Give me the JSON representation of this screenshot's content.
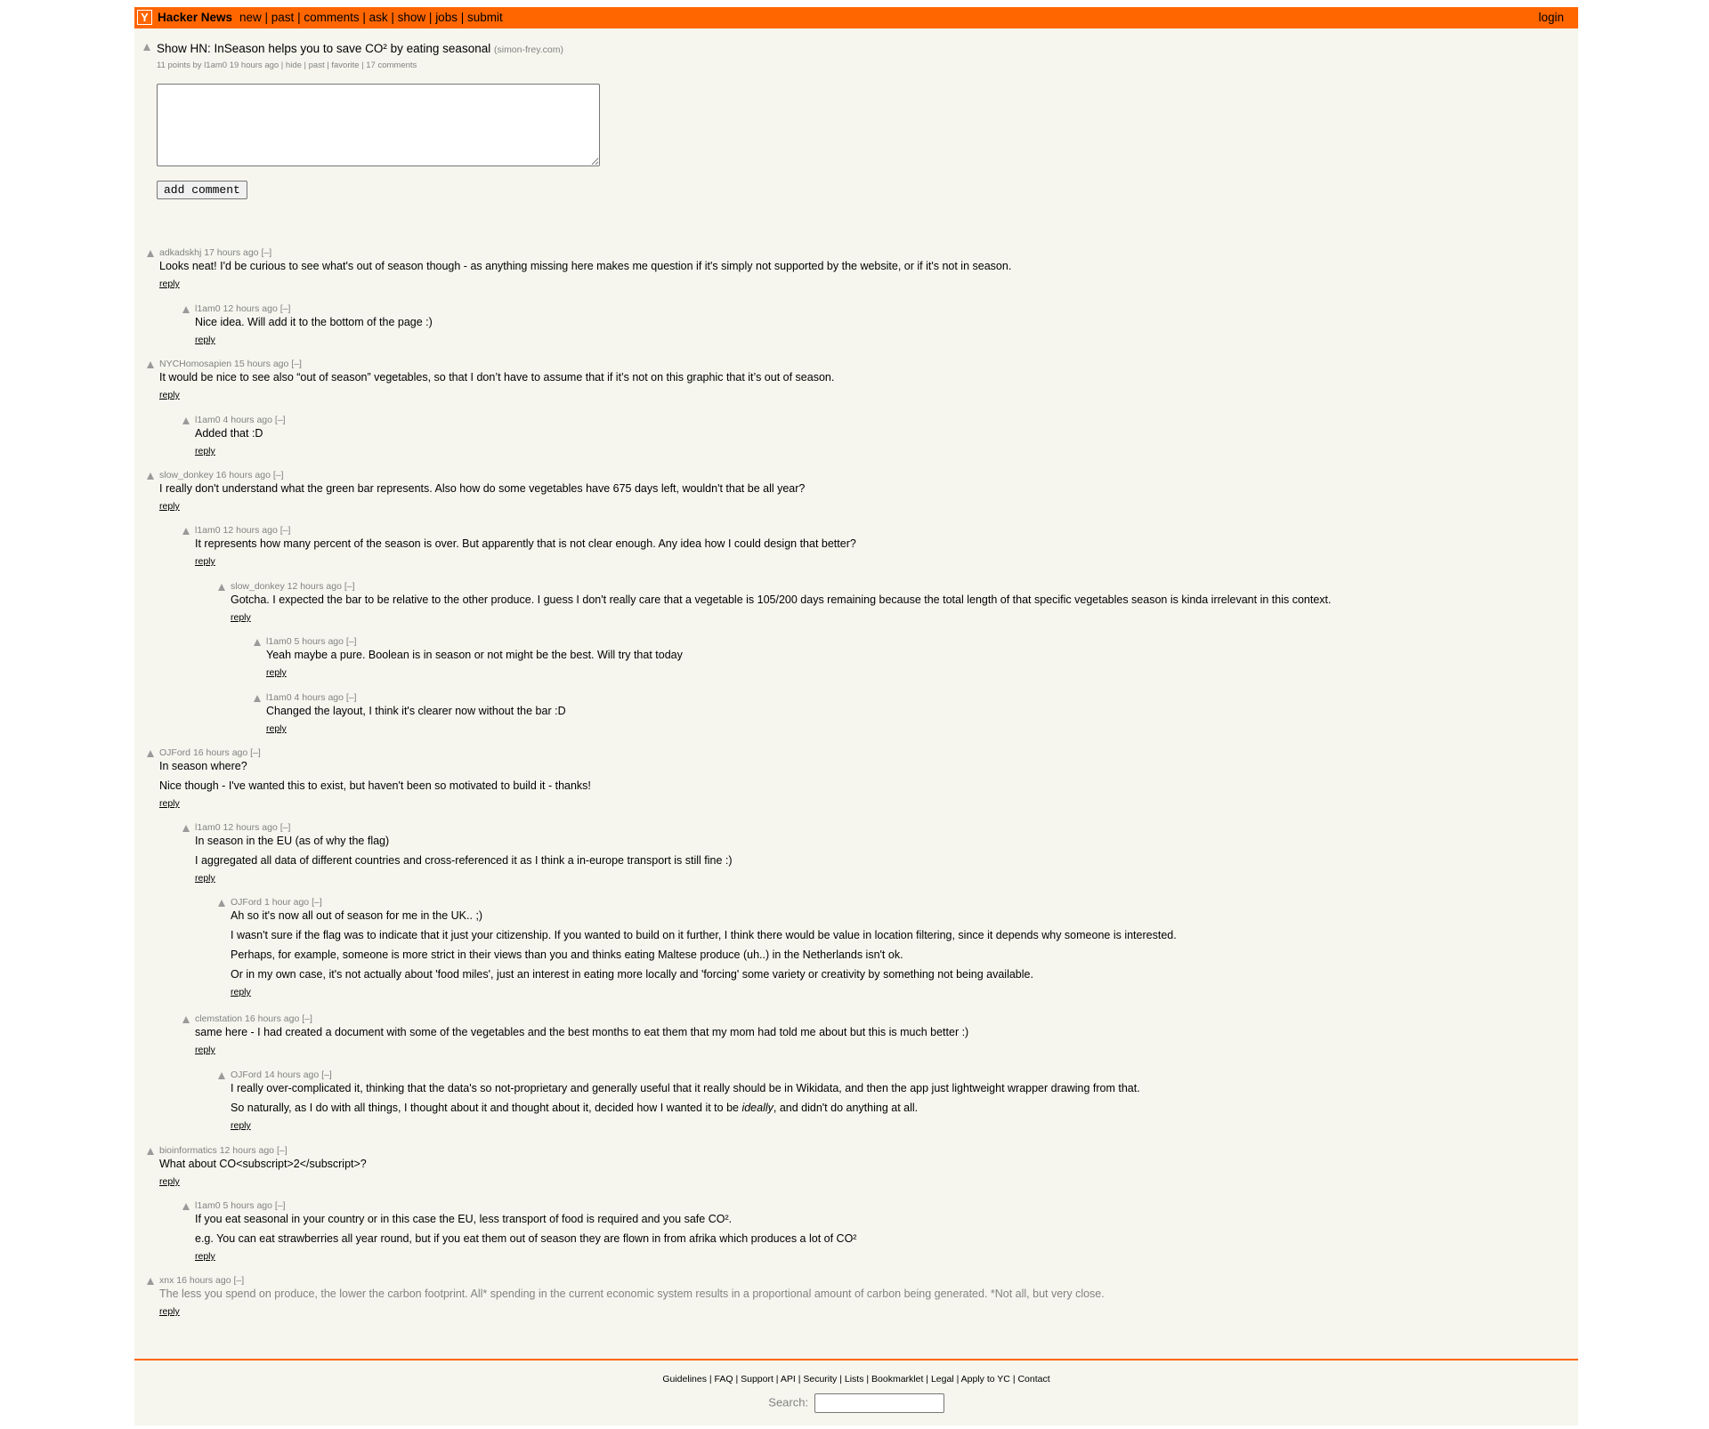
{
  "header": {
    "logo": "Y",
    "site_name": "Hacker News",
    "nav": [
      "new",
      "past",
      "comments",
      "ask",
      "show",
      "jobs",
      "submit"
    ],
    "login": "login"
  },
  "story": {
    "title": "Show HN: InSeason helps you to save CO² by eating seasonal",
    "site": "(simon-frey.com)",
    "points": "11 points",
    "by": "by",
    "user": "l1am0",
    "age": "19 hours ago",
    "actions": [
      "hide",
      "past",
      "favorite"
    ],
    "comments_link": "17 comments"
  },
  "reply_form": {
    "button": "add comment"
  },
  "comments": [
    {
      "user": "adkadskhj",
      "age": "17 hours ago",
      "toggle": "[–]",
      "paragraphs": [
        "Looks neat! I'd be curious to see what's out of season though - as anything missing here makes me question if it's simply not supported by the website, or if it's not in season."
      ],
      "reply": "reply"
    },
    {
      "user": "l1am0",
      "age": "12 hours ago",
      "toggle": "[–]",
      "paragraphs": [
        "Nice idea. Will add it to the bottom of the page :)"
      ],
      "reply": "reply"
    },
    {
      "user": "NYCHomosapien",
      "age": "15 hours ago",
      "toggle": "[–]",
      "paragraphs": [
        "It would be nice to see also “out of season” vegetables, so that I don’t have to assume that if it’s not on this graphic that it’s out of season."
      ],
      "reply": "reply"
    },
    {
      "user": "l1am0",
      "age": "4 hours ago",
      "toggle": "[–]",
      "paragraphs": [
        "Added that :D"
      ],
      "reply": "reply"
    },
    {
      "user": "slow_donkey",
      "age": "16 hours ago",
      "toggle": "[–]",
      "paragraphs": [
        "I really don't understand what the green bar represents. Also how do some vegetables have 675 days left, wouldn't that be all year?"
      ],
      "reply": "reply"
    },
    {
      "user": "l1am0",
      "age": "12 hours ago",
      "toggle": "[–]",
      "paragraphs": [
        "It represents how many percent of the season is over. But apparently that is not clear enough. Any idea how I could design that better?"
      ],
      "reply": "reply"
    },
    {
      "user": "slow_donkey",
      "age": "12 hours ago",
      "toggle": "[–]",
      "paragraphs": [
        "Gotcha. I expected the bar to be relative to the other produce. I guess I don't really care that a vegetable is 105/200 days remaining because the total length of that specific vegetables season is kinda irrelevant in this context."
      ],
      "reply": "reply"
    },
    {
      "user": "l1am0",
      "age": "5 hours ago",
      "toggle": "[–]",
      "paragraphs": [
        "Yeah maybe a pure. Boolean is in season or not might be the best. Will try that today"
      ],
      "reply": "reply"
    },
    {
      "user": "l1am0",
      "age": "4 hours ago",
      "toggle": "[–]",
      "paragraphs": [
        "Changed the layout, I think it's clearer now without the bar :D"
      ],
      "reply": "reply"
    },
    {
      "user": "OJFord",
      "age": "16 hours ago",
      "toggle": "[–]",
      "paragraphs": [
        "In season where?",
        "Nice though - I've wanted this to exist, but haven't been so motivated to build it - thanks!"
      ],
      "reply": "reply"
    },
    {
      "user": "l1am0",
      "age": "12 hours ago",
      "toggle": "[–]",
      "paragraphs": [
        "In season in the EU (as of why the flag)",
        "I aggregated all data of different countries and cross-referenced it as I think a in-europe transport is still fine :)"
      ],
      "reply": "reply"
    },
    {
      "user": "OJFord",
      "age": "1 hour ago",
      "toggle": "[–]",
      "paragraphs": [
        "Ah so it's now all out of season for me in the UK.. ;)",
        "I wasn't sure if the flag was to indicate that it just your citizenship. If you wanted to build on it further, I think there would be value in location filtering, since it depends why someone is interested.",
        "Perhaps, for example, someone is more strict in their views than you and thinks eating Maltese produce (uh..) in the Netherlands isn't ok.",
        "Or in my own case, it's not actually about 'food miles', just an interest in eating more locally and 'forcing' some variety or creativity by something not being available."
      ],
      "reply": "reply"
    },
    {
      "user": "clemstation",
      "age": "16 hours ago",
      "toggle": "[–]",
      "paragraphs": [
        "same here - I had created a document with some of the vegetables and the best months to eat them that my mom had told me about but this is much better :)"
      ],
      "reply": "reply"
    },
    {
      "user": "OJFord",
      "age": "14 hours ago",
      "toggle": "[–]",
      "paragraphs": [
        "I really over-complicated it, thinking that the data's so not-proprietary and generally useful that it really should be in Wikidata, and then the app just lightweight wrapper drawing from that."
      ],
      "para2_pre": "So naturally, as I do with all things, I thought about it and thought about it, decided how I wanted it to be ",
      "para2_em": "ideally",
      "para2_post": ", and didn't do anything at all.",
      "reply": "reply"
    },
    {
      "user": "bioinformatics",
      "age": "12 hours ago",
      "toggle": "[–]",
      "paragraphs": [
        "What about CO<subscript>2</subscript>?"
      ],
      "reply": "reply"
    },
    {
      "user": "l1am0",
      "age": "5 hours ago",
      "toggle": "[–]",
      "paragraphs": [
        "If you eat seasonal in your country or in this case the EU, less transport of food is required and you safe CO².",
        "e.g. You can eat strawberries all year round, but if you eat them out of season they are flown in from afrika which produces a lot of CO²"
      ],
      "reply": "reply"
    },
    {
      "user": "xnx",
      "age": "16 hours ago",
      "toggle": "[–]",
      "paragraphs": [
        "The less you spend on produce, the lower the carbon footprint. All* spending in the current economic system results in a proportional amount of carbon being generated. *Not all, but very close."
      ],
      "reply": "reply"
    }
  ],
  "footer": {
    "links": [
      "Guidelines",
      "FAQ",
      "Support",
      "API",
      "Security",
      "Lists",
      "Bookmarklet",
      "Legal",
      "Apply to YC",
      "Contact"
    ],
    "search_label": "Search:"
  },
  "colors": {
    "brand": "#ff6600",
    "background": "#f6f6ef",
    "subtext": "#828282"
  }
}
